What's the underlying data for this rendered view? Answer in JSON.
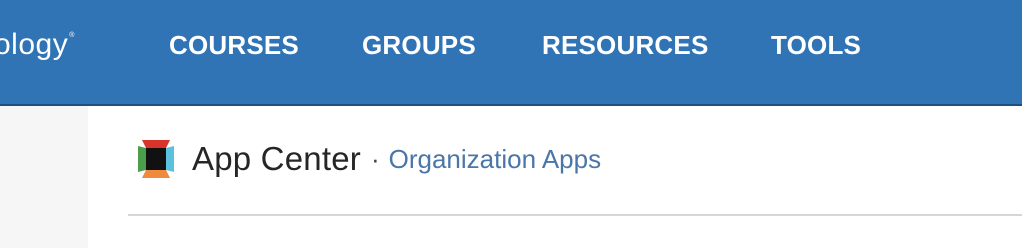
{
  "header": {
    "logo_text": "ology",
    "logo_mark": "®",
    "nav": [
      {
        "label": "COURSES"
      },
      {
        "label": "GROUPS"
      },
      {
        "label": "RESOURCES"
      },
      {
        "label": "TOOLS"
      }
    ]
  },
  "page": {
    "icon": "app-center-icon",
    "title": "App Center",
    "separator": "·",
    "subtitle": "Organization Apps"
  },
  "colors": {
    "header_bg": "#3174b5",
    "link": "#4a76a8"
  }
}
